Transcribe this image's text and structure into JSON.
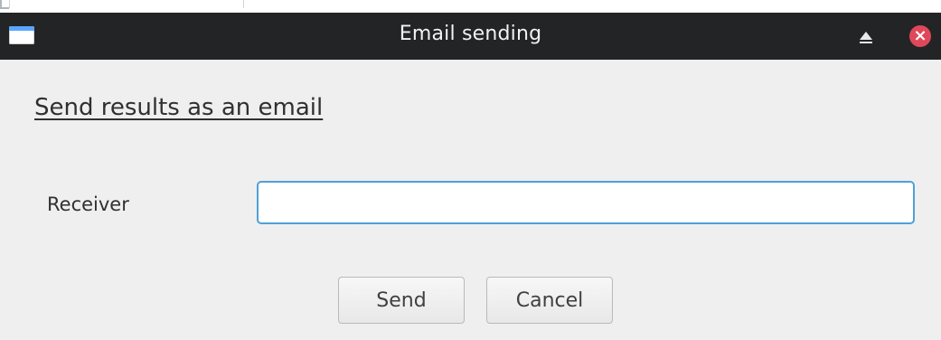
{
  "window": {
    "title": "Email sending"
  },
  "titlebar": {
    "maximize_icon": "eject-icon",
    "close_icon": "close-icon"
  },
  "content": {
    "heading": "Send results as an email",
    "receiver_label": "Receiver",
    "receiver_value": "",
    "receiver_placeholder": ""
  },
  "buttons": {
    "send_label": "Send",
    "cancel_label": "Cancel"
  },
  "colors": {
    "titlebar_bg": "#232425",
    "content_bg": "#efefef",
    "focus_border": "#4ea1d6",
    "close_red": "#e0485a"
  }
}
